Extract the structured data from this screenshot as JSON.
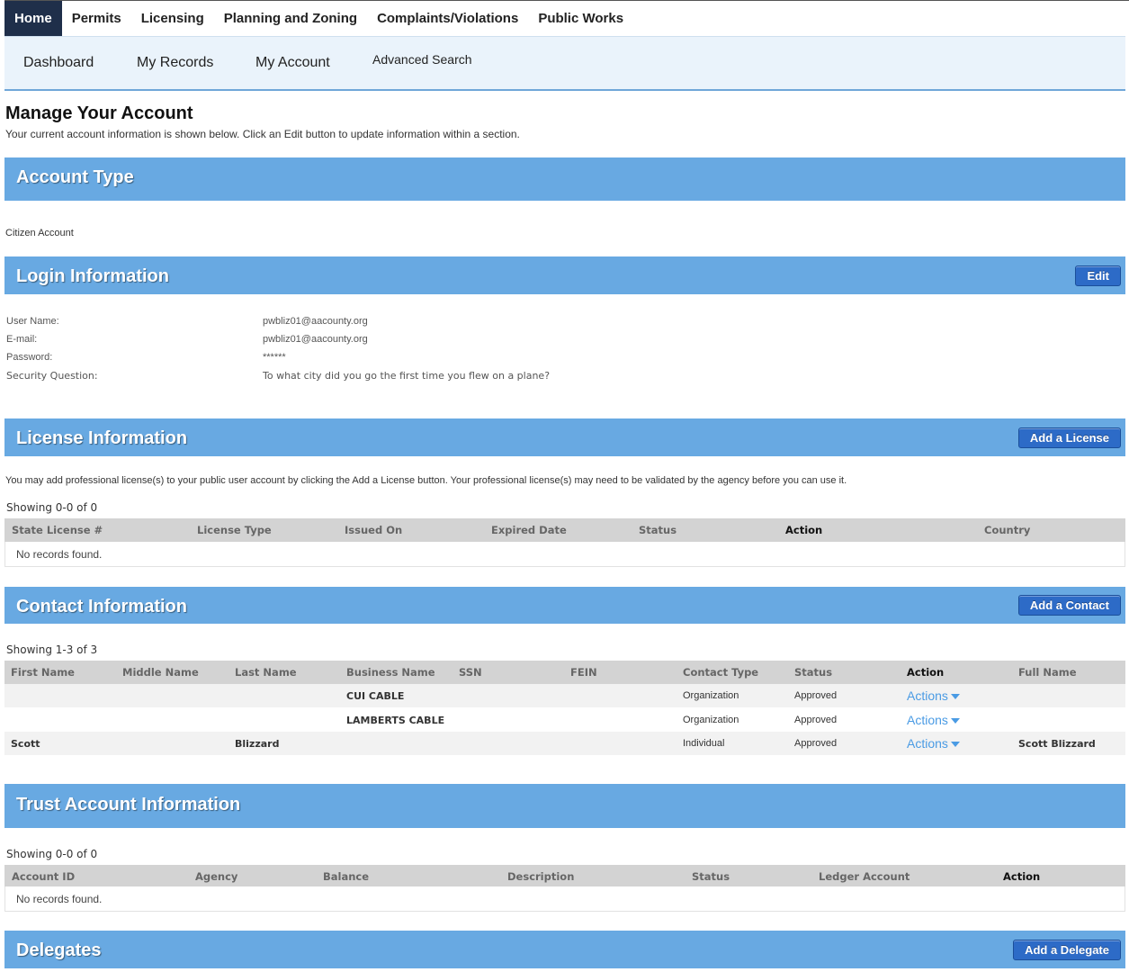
{
  "topnav": {
    "tabs": [
      {
        "label": "Home",
        "active": true
      },
      {
        "label": "Permits"
      },
      {
        "label": "Licensing"
      },
      {
        "label": "Planning and Zoning"
      },
      {
        "label": "Complaints/Violations"
      },
      {
        "label": "Public Works"
      }
    ]
  },
  "subnav": {
    "dashboard": "Dashboard",
    "my_records": "My Records",
    "my_account": "My Account",
    "advanced_search": "Advanced Search"
  },
  "page": {
    "title": "Manage Your Account",
    "intro": "Your current account information is shown below. Click an Edit button to update information within a section."
  },
  "account_type": {
    "title": "Account Type",
    "value": "Citizen Account"
  },
  "login": {
    "title": "Login Information",
    "edit_label": "Edit",
    "rows": [
      {
        "label": "User Name:",
        "value": "pwbliz01@aacounty.org"
      },
      {
        "label": "E-mail:",
        "value": "pwbliz01@aacounty.org"
      },
      {
        "label": "Password:",
        "value": "******"
      },
      {
        "label": "Security Question:",
        "value": "To what city did you go the first time you flew on a plane?"
      }
    ]
  },
  "license": {
    "title": "License Information",
    "button": "Add a License",
    "note": "You may add professional license(s) to your public user account by clicking the Add a License button. Your professional license(s) may need to be validated by the agency before you can use it.",
    "showing": "Showing 0-0 of 0",
    "columns": [
      "State License #",
      "License Type",
      "Issued On",
      "Expired Date",
      "Status",
      "Action",
      "Country"
    ],
    "empty": "No records found."
  },
  "contact": {
    "title": "Contact Information",
    "button": "Add a Contact",
    "showing": "Showing 1-3 of 3",
    "columns": [
      "First Name",
      "Middle Name",
      "Last Name",
      "Business Name",
      "SSN",
      "FEIN",
      "Contact Type",
      "Status",
      "Action",
      "Full Name"
    ],
    "rows": [
      {
        "first": "",
        "middle": "",
        "last": "",
        "business": "CUI CABLE",
        "ssn": "",
        "fein": "",
        "type": "Organization",
        "status": "Approved",
        "action": "Actions",
        "full": ""
      },
      {
        "first": "",
        "middle": "",
        "last": "",
        "business": "LAMBERTS CABLE",
        "ssn": "",
        "fein": "",
        "type": "Organization",
        "status": "Approved",
        "action": "Actions",
        "full": ""
      },
      {
        "first": "Scott",
        "middle": "",
        "last": "Blizzard",
        "business": "",
        "ssn": "",
        "fein": "",
        "type": "Individual",
        "status": "Approved",
        "action": "Actions",
        "full": "Scott Blizzard"
      }
    ]
  },
  "trust": {
    "title": "Trust Account Information",
    "showing": "Showing 0-0 of 0",
    "columns": [
      "Account ID",
      "Agency",
      "Balance",
      "Description",
      "Status",
      "Ledger Account",
      "Action"
    ],
    "empty": "No records found."
  },
  "delegates": {
    "title": "Delegates",
    "button": "Add a Delegate"
  },
  "colors": {
    "section_bar": "#68a9e2",
    "nav_active": "#1f2f4a",
    "button": "#2d6bc7",
    "actions_link": "#4a9be4"
  }
}
